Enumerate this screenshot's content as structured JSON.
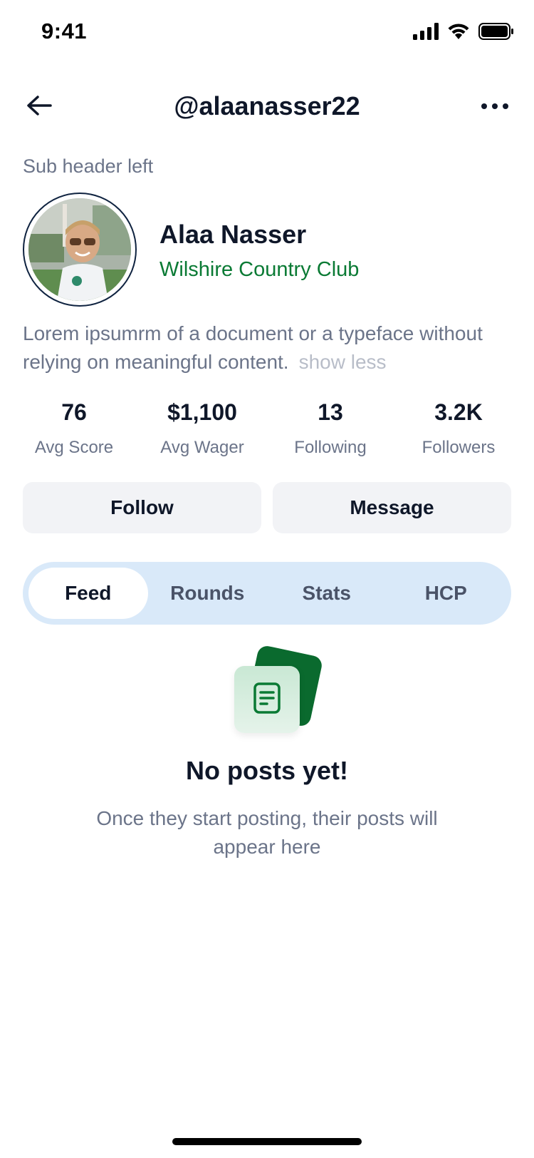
{
  "status_bar": {
    "time": "9:41",
    "signal_icon": "cellular-signal-icon",
    "wifi_icon": "wifi-icon",
    "battery_icon": "battery-icon"
  },
  "nav": {
    "title": "@alaanasser22",
    "back_icon": "arrow-left-icon",
    "more_icon": "more-horizontal-icon"
  },
  "sub_header": "Sub header left",
  "profile": {
    "name": "Alaa Nasser",
    "club": "Wilshire Country Club",
    "avatar": "avatar",
    "bio": "Lorem ipsumrm of a document or a typeface without relying on meaningful content.",
    "show_less": "show less"
  },
  "stats": [
    {
      "value": "76",
      "label": "Avg Score"
    },
    {
      "value": "$1,100",
      "label": "Avg Wager"
    },
    {
      "value": "13",
      "label": "Following"
    },
    {
      "value": "3.2K",
      "label": "Followers"
    }
  ],
  "actions": {
    "follow": "Follow",
    "message": "Message"
  },
  "tabs": [
    {
      "label": "Feed",
      "active": true
    },
    {
      "label": "Rounds",
      "active": false
    },
    {
      "label": "Stats",
      "active": false
    },
    {
      "label": "HCP",
      "active": false
    }
  ],
  "empty_state": {
    "icon": "document-icon",
    "title": "No posts yet!",
    "text": "Once they start posting, their posts will appear here"
  },
  "colors": {
    "accent_green": "#0a7a34",
    "tab_bg": "#d9e9f9",
    "button_bg": "#f2f3f6",
    "text_primary": "#0f1729",
    "text_secondary": "#6b7489"
  }
}
